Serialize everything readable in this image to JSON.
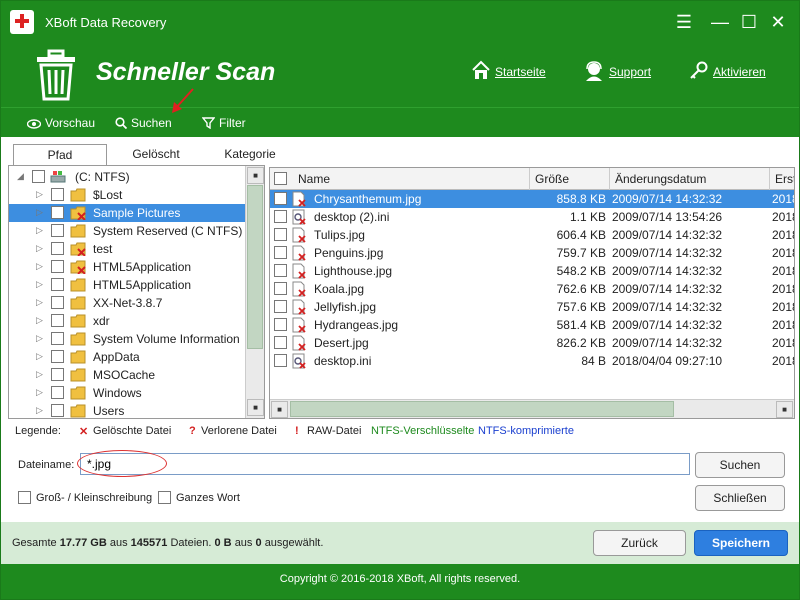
{
  "window": {
    "title": "XBoft Data Recovery",
    "controls": [
      "☰",
      "—",
      "☐",
      "✕"
    ]
  },
  "header": {
    "scan_title": "Schneller Scan",
    "links": {
      "home": "Startseite",
      "support": "Support",
      "activate": "Aktivieren"
    }
  },
  "toolbar": {
    "preview": "Vorschau",
    "search": "Suchen",
    "filter": "Filter"
  },
  "tabs": [
    "Pfad",
    "Gelöscht",
    "Kategorie"
  ],
  "tree": {
    "root": "(C: NTFS)",
    "items": [
      {
        "label": "$Lost",
        "deleted": false,
        "selected": false
      },
      {
        "label": "Sample Pictures",
        "deleted": true,
        "selected": true
      },
      {
        "label": "System Reserved (C NTFS)",
        "deleted": false,
        "selected": false
      },
      {
        "label": "test",
        "deleted": true,
        "selected": false
      },
      {
        "label": "HTML5Application",
        "deleted": true,
        "selected": false
      },
      {
        "label": "HTML5Application",
        "deleted": false,
        "selected": false
      },
      {
        "label": "XX-Net-3.8.7",
        "deleted": false,
        "selected": false
      },
      {
        "label": "xdr",
        "deleted": false,
        "selected": false
      },
      {
        "label": "System Volume Information",
        "deleted": false,
        "selected": false
      },
      {
        "label": "AppData",
        "deleted": false,
        "selected": false
      },
      {
        "label": "MSOCache",
        "deleted": false,
        "selected": false
      },
      {
        "label": "Windows",
        "deleted": false,
        "selected": false
      },
      {
        "label": "Users",
        "deleted": false,
        "selected": false
      }
    ]
  },
  "filelist": {
    "columns": {
      "name": "Name",
      "size": "Größe",
      "date": "Änderungsdatum",
      "created": "Erst"
    },
    "rows": [
      {
        "name": "Chrysanthemum.jpg",
        "size": "858.8 KB",
        "date": "2009/07/14 14:32:32",
        "created": "2018",
        "type": "jpg",
        "selected": true
      },
      {
        "name": "desktop (2).ini",
        "size": "1.1 KB",
        "date": "2009/07/14 13:54:26",
        "created": "2018",
        "type": "ini",
        "selected": false
      },
      {
        "name": "Tulips.jpg",
        "size": "606.4 KB",
        "date": "2009/07/14 14:32:32",
        "created": "2018",
        "type": "jpg",
        "selected": false
      },
      {
        "name": "Penguins.jpg",
        "size": "759.7 KB",
        "date": "2009/07/14 14:32:32",
        "created": "2018",
        "type": "jpg",
        "selected": false
      },
      {
        "name": "Lighthouse.jpg",
        "size": "548.2 KB",
        "date": "2009/07/14 14:32:32",
        "created": "2018",
        "type": "jpg",
        "selected": false
      },
      {
        "name": "Koala.jpg",
        "size": "762.6 KB",
        "date": "2009/07/14 14:32:32",
        "created": "2018",
        "type": "jpg",
        "selected": false
      },
      {
        "name": "Jellyfish.jpg",
        "size": "757.6 KB",
        "date": "2009/07/14 14:32:32",
        "created": "2018",
        "type": "jpg",
        "selected": false
      },
      {
        "name": "Hydrangeas.jpg",
        "size": "581.4 KB",
        "date": "2009/07/14 14:32:32",
        "created": "2018",
        "type": "jpg",
        "selected": false
      },
      {
        "name": "Desert.jpg",
        "size": "826.2 KB",
        "date": "2009/07/14 14:32:32",
        "created": "2018",
        "type": "jpg",
        "selected": false
      },
      {
        "name": "desktop.ini",
        "size": "84 B",
        "date": "2018/04/04 09:27:10",
        "created": "2018",
        "type": "ini",
        "selected": false
      }
    ]
  },
  "legend": {
    "label": "Legende:",
    "deleted": "Gelöschte Datei",
    "lost": "Verlorene Datei",
    "raw": "RAW-Datei",
    "encrypted": "NTFS-Verschlüsselte",
    "compressed": "NTFS-komprimierte",
    "colors": {
      "deleted": "#d32020",
      "encrypted": "#1e8a1e",
      "compressed": "#1a3fcf"
    }
  },
  "search": {
    "filename_label": "Dateiname:",
    "filename_value": "*.jpg",
    "search_button": "Suchen",
    "close_button": "Schließen",
    "case_sensitive": "Groß- / Kleinschreibung",
    "whole_word": "Ganzes Wort"
  },
  "status": {
    "total_prefix": "Gesamte",
    "total_size": "17.77 GB",
    "from": "aus",
    "total_files": "145571",
    "files_word": "Dateien.",
    "selected_size": "0 B",
    "from2": "aus",
    "selected_count": "0",
    "selected_word": "ausgewählt.",
    "back_button": "Zurück",
    "save_button": "Speichern"
  },
  "footer": {
    "copyright": "Copyright © 2016-2018 XBoft, All rights reserved."
  },
  "colors": {
    "brand_green": "#1e8a1e",
    "selection_blue": "#3d8ee0",
    "primary_button": "#2e7fe0",
    "status_bg": "#d6ebd6"
  }
}
